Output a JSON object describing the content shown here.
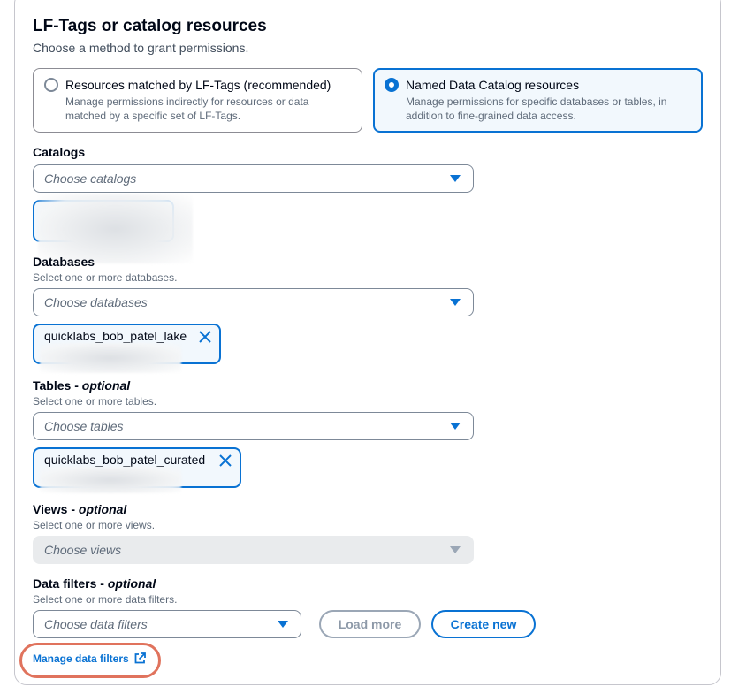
{
  "section": {
    "title": "LF-Tags or catalog resources",
    "subtitle": "Choose a method to grant permissions."
  },
  "methods": [
    {
      "label": "Resources matched by LF-Tags (recommended)",
      "description": "Manage permissions indirectly for resources or data matched by a specific set of LF-Tags.",
      "selected": false
    },
    {
      "label": "Named Data Catalog resources",
      "description": "Manage permissions for specific databases or tables, in addition to fine-grained data access.",
      "selected": true
    }
  ],
  "catalogs": {
    "label": "Catalogs",
    "placeholder": "Choose catalogs"
  },
  "databases": {
    "label": "Databases",
    "description": "Select one or more databases.",
    "placeholder": "Choose databases",
    "token": "quicklabs_bob_patel_lake"
  },
  "tables": {
    "label": "Tables",
    "optional": "optional",
    "description": "Select one or more tables.",
    "placeholder": "Choose tables",
    "token": "quicklabs_bob_patel_curated"
  },
  "views": {
    "label": "Views",
    "optional": "optional",
    "description": "Select one or more views.",
    "placeholder": "Choose views"
  },
  "data_filters": {
    "label": "Data filters",
    "optional": "optional",
    "description": "Select one or more data filters.",
    "placeholder": "Choose data filters",
    "load_more": "Load more",
    "create_new": "Create new",
    "manage_link": "Manage data filters"
  },
  "colors": {
    "accent": "#0972d3",
    "highlight_ring": "#e0735d"
  }
}
